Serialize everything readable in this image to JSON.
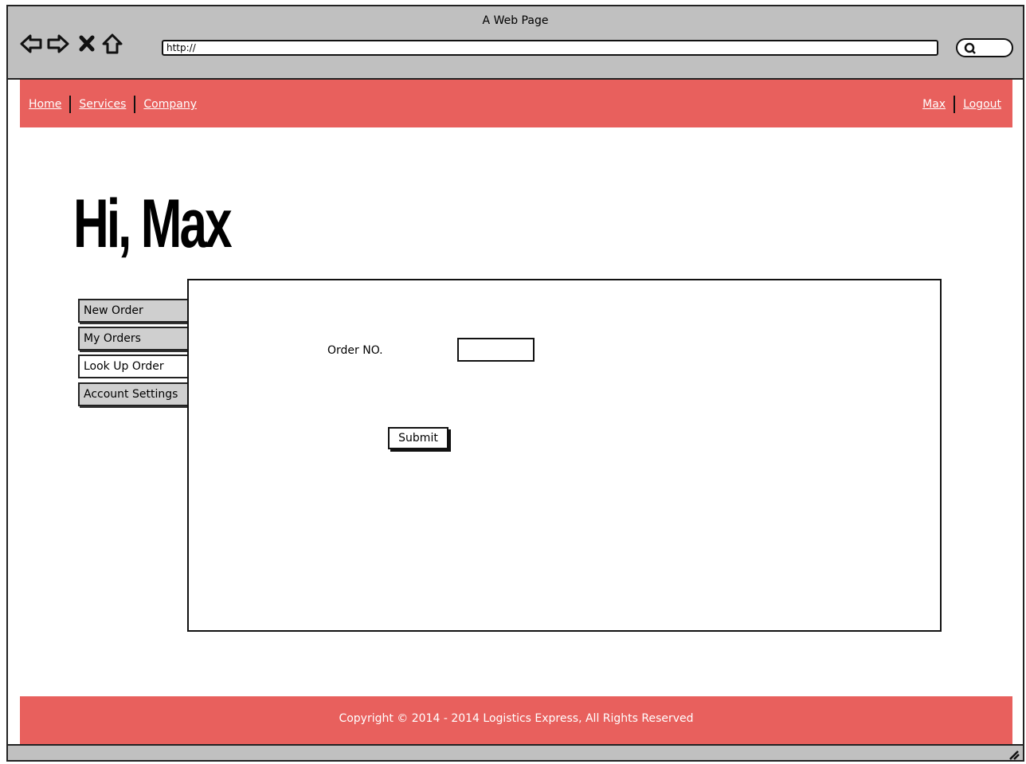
{
  "window": {
    "title": "A Web Page"
  },
  "browser": {
    "url": "http://",
    "icons": [
      "back-arrow-icon",
      "forward-arrow-icon",
      "close-x-icon",
      "home-icon",
      "search-icon"
    ]
  },
  "topnav": {
    "left_links": [
      "Home",
      "Services",
      "Company"
    ],
    "right_links": [
      "Max",
      "Logout"
    ],
    "color": "#e8605d"
  },
  "page": {
    "greeting": "Hi, Max"
  },
  "sidebar": {
    "items": [
      {
        "label": "New Order"
      },
      {
        "label": "My Orders"
      },
      {
        "label": "Look Up Order",
        "active": true
      },
      {
        "label": "Account Settings"
      }
    ]
  },
  "form": {
    "order_label": "Order NO.",
    "order_value": "",
    "submit_label": "Submit"
  },
  "footer": {
    "text": "Copyright © 2014 - 2014 Logistics Express, All Rights Reserved"
  }
}
